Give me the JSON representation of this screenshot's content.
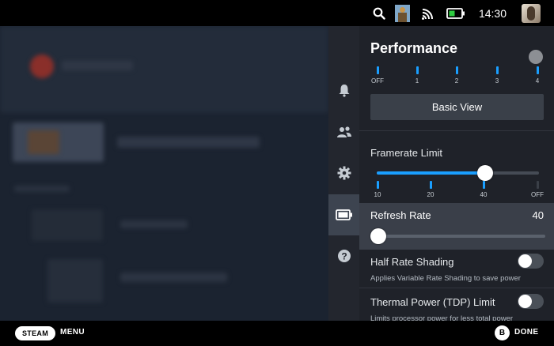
{
  "status_bar": {
    "time": "14:30",
    "icons": [
      "search-icon",
      "notification-thumbnail",
      "wifi-icon",
      "battery-icon",
      "user-avatar"
    ],
    "battery_color": "#2ecc40"
  },
  "rail": {
    "items": [
      "bell-icon",
      "friends-icon",
      "gear-icon",
      "battery-icon",
      "help-icon"
    ],
    "active_index": 3
  },
  "panel": {
    "title": "Performance",
    "profile_ticks": [
      "OFF",
      "1",
      "2",
      "3",
      "4"
    ],
    "basic_view_label": "Basic View",
    "framerate": {
      "label": "Framerate Limit",
      "ticks": [
        "10",
        "20",
        "40",
        "OFF"
      ],
      "selected": "40",
      "fill_fraction": 0.667
    },
    "refresh_rate": {
      "label": "Refresh Rate",
      "value": "40",
      "fill_fraction": 0
    },
    "half_rate_shading": {
      "label": "Half Rate Shading",
      "description": "Applies Variable Rate Shading to save power",
      "enabled": false
    },
    "tdp": {
      "label": "Thermal Power (TDP) Limit",
      "description": "Limits processor power for less total power",
      "enabled": false
    },
    "accent_color": "#1a9fff"
  },
  "bottom_bar": {
    "steam_label": "STEAM",
    "menu_label": "MENU",
    "b_button": "B",
    "done_label": "DONE"
  }
}
